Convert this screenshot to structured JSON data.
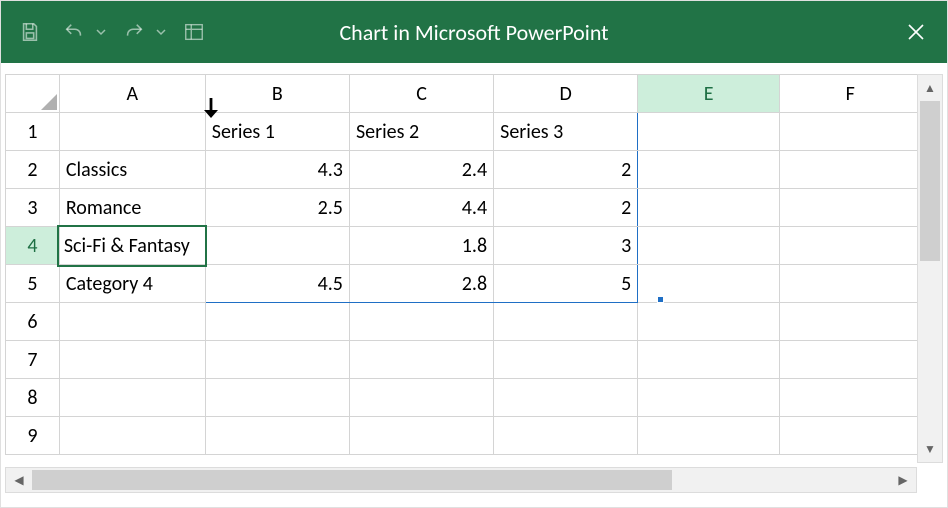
{
  "window": {
    "title": "Chart in Microsoft PowerPoint",
    "accent_color": "#217346"
  },
  "qat": {
    "save_tip": "Save",
    "undo_tip": "Undo",
    "redo_tip": "Redo",
    "customize_tip": "Customize Quick Access Toolbar"
  },
  "sheet": {
    "columns": [
      "A",
      "B",
      "C",
      "D",
      "E",
      "F"
    ],
    "active_column": "E",
    "active_row": 4,
    "active_cell": "A4",
    "insert_marker_between": [
      "A",
      "B"
    ],
    "data_range": "A1:D5",
    "rows": [
      {
        "n": 1,
        "cells": {
          "A": "",
          "B": "Series 1",
          "C": "Series 2",
          "D": "Series 3"
        }
      },
      {
        "n": 2,
        "cells": {
          "A": "Classics",
          "B": "4.3",
          "C": "2.4",
          "D": "2"
        }
      },
      {
        "n": 3,
        "cells": {
          "A": "Romance",
          "B": "2.5",
          "C": "4.4",
          "D": "2"
        }
      },
      {
        "n": 4,
        "cells": {
          "A": "Sci-Fi & Fantasy",
          "B": "",
          "C": "1.8",
          "D": "3"
        }
      },
      {
        "n": 5,
        "cells": {
          "A": "Category 4",
          "B": "4.5",
          "C": "2.8",
          "D": "5"
        }
      },
      {
        "n": 6,
        "cells": {
          "A": "",
          "B": "",
          "C": "",
          "D": ""
        }
      },
      {
        "n": 7,
        "cells": {
          "A": "",
          "B": "",
          "C": "",
          "D": ""
        }
      },
      {
        "n": 8,
        "cells": {
          "A": "",
          "B": "",
          "C": "",
          "D": ""
        }
      },
      {
        "n": 9,
        "cells": {
          "A": "",
          "B": "",
          "C": "",
          "D": ""
        }
      }
    ]
  },
  "chart_data": {
    "type": "bar",
    "categories": [
      "Classics",
      "Romance",
      "Sci-Fi & Fantasy",
      "Category 4"
    ],
    "series": [
      {
        "name": "Series 1",
        "values": [
          4.3,
          2.5,
          null,
          4.5
        ]
      },
      {
        "name": "Series 2",
        "values": [
          2.4,
          4.4,
          1.8,
          2.8
        ]
      },
      {
        "name": "Series 3",
        "values": [
          2,
          2,
          3,
          5
        ]
      }
    ],
    "title": "",
    "xlabel": "",
    "ylabel": ""
  }
}
